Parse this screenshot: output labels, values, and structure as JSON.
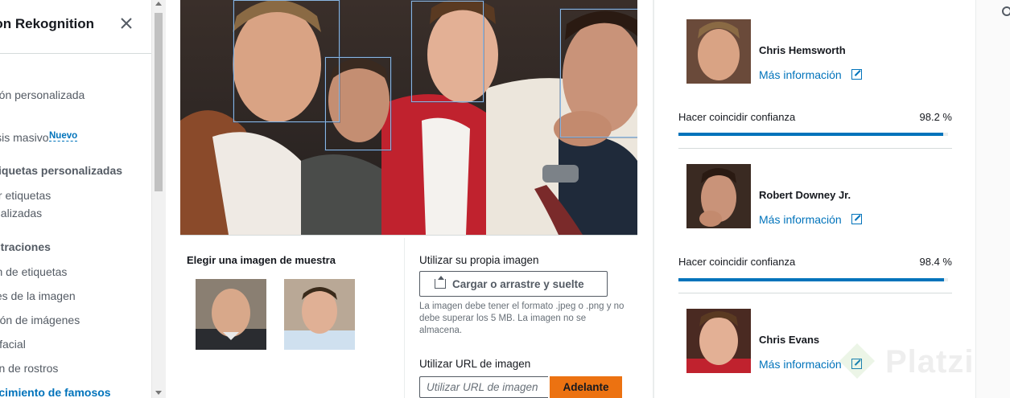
{
  "sidebar": {
    "title": "Amazon Rekognition",
    "close_icon": "close-icon",
    "items": [
      {
        "label": "Detección personalizada",
        "type": "link"
      },
      {
        "label": "Análisis masivo",
        "type": "link",
        "badge": "Nuevo"
      },
      {
        "label": "Etiquetas personalizadas",
        "type": "heading"
      },
      {
        "label": "Usar etiquetas",
        "type": "link"
      },
      {
        "label": "personalizadas",
        "type": "link"
      },
      {
        "label": "Demostraciones",
        "type": "heading"
      },
      {
        "label": "Detección de etiquetas",
        "type": "link"
      },
      {
        "label": "Propiedades de la imagen",
        "type": "link"
      },
      {
        "label": "Moderación de imágenes",
        "type": "link"
      },
      {
        "label": "Análisis facial",
        "type": "link"
      },
      {
        "label": "Comparación de rostros",
        "type": "link"
      },
      {
        "label": "Reconocimiento de famosos",
        "type": "link",
        "active": true
      }
    ]
  },
  "main": {
    "sample_heading": "Elegir una imagen de muestra",
    "own_image_heading": "Utilizar su propia imagen",
    "upload_button": "Cargar o arrastre y suelte",
    "upload_note": "La imagen debe tener el formato .jpeg o .png y no debe superar los 5 MB. La imagen no se almacena.",
    "url_heading": "Utilizar URL de imagen",
    "url_placeholder": "Utilizar URL de imagen",
    "go_button": "Adelante"
  },
  "results": [
    {
      "name": "Chris Hemsworth",
      "link": "Más información",
      "confidence_label": "Hacer coincidir confianza",
      "confidence": "98.2 %",
      "confidence_value": 98.2
    },
    {
      "name": "Robert Downey Jr.",
      "link": "Más información",
      "confidence_label": "Hacer coincidir confianza",
      "confidence": "98.4 %",
      "confidence_value": 98.4
    },
    {
      "name": "Chris Evans",
      "link": "Más información"
    }
  ],
  "watermark": "Platzi",
  "colors": {
    "accent": "#0073bb",
    "go_button": "#ec7211",
    "face_box": "#8ab6e2"
  }
}
